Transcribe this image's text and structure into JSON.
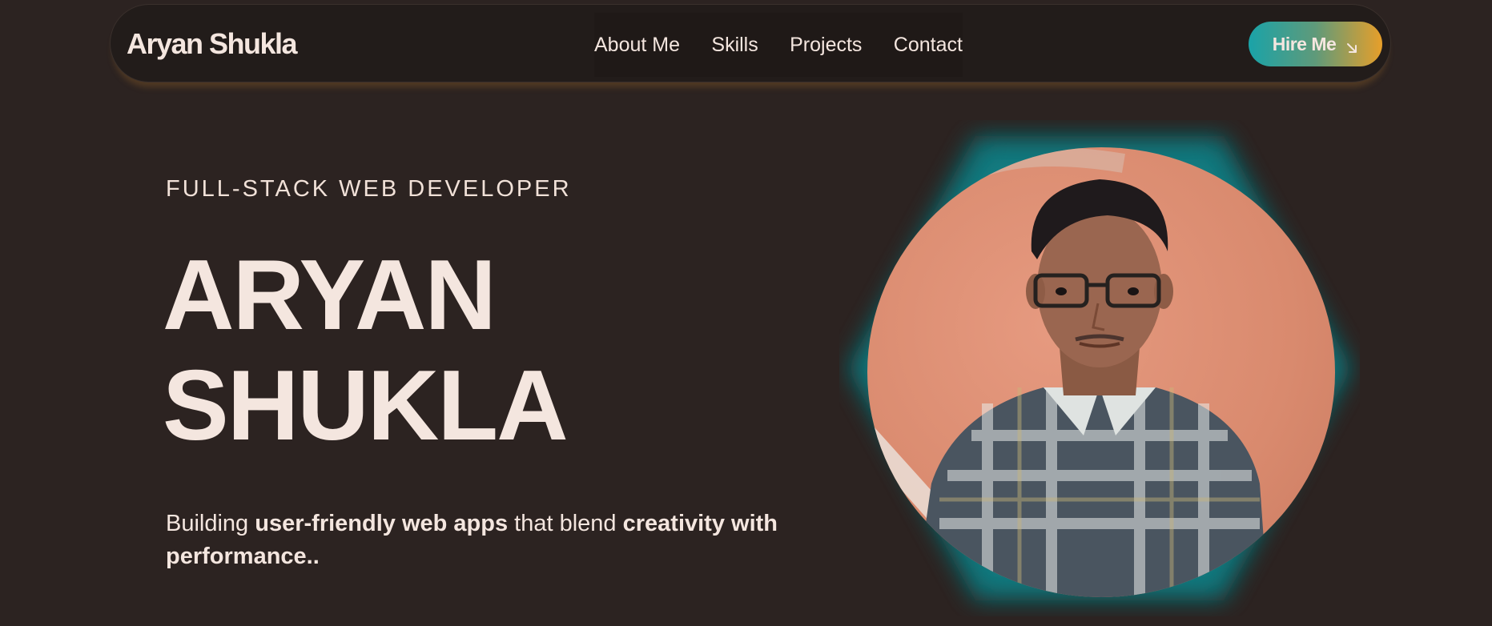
{
  "navbar": {
    "brand": "Aryan Shukla",
    "links": [
      "About Me",
      "Skills",
      "Projects",
      "Contact"
    ],
    "cta_label": "Hire Me",
    "cta_icon": "arrow-down-right-icon"
  },
  "hero": {
    "subtitle": "FULL-STACK WEB DEVELOPER",
    "name_line1": "ARYAN",
    "name_line2": "SHUKLA",
    "tagline_parts": [
      "Building ",
      "user-friendly web apps",
      " that blend ",
      "creativity with performance",
      ".."
    ],
    "portrait_alt": "Portrait photo"
  },
  "colors": {
    "background": "#2c2321",
    "navbar": "#221c1a",
    "text": "#f4e6df",
    "accent_teal": "#1aa3a8",
    "accent_orange": "#e79f2a"
  }
}
